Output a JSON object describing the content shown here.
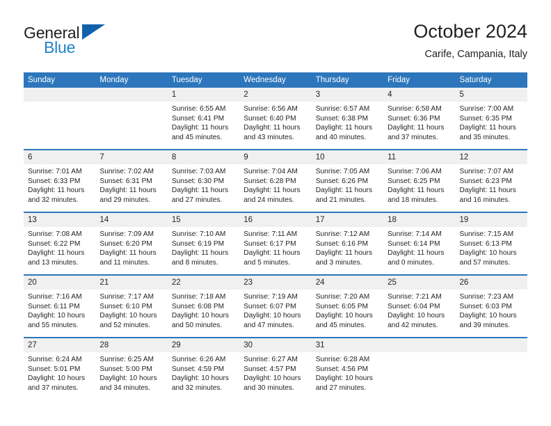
{
  "brand": {
    "name_part1": "General",
    "name_part2": "Blue",
    "triangle_color": "#1162ab",
    "blue_color": "#1d82c8"
  },
  "header": {
    "title": "October 2024",
    "location": "Carife, Campania, Italy"
  },
  "theme": {
    "header_row_bg": "#2d76bb",
    "daynum_bg": "#f0f0f0",
    "separator_color": "#2d76bb",
    "text_color": "#231f20"
  },
  "weekday_headers": [
    "Sunday",
    "Monday",
    "Tuesday",
    "Wednesday",
    "Thursday",
    "Friday",
    "Saturday"
  ],
  "weeks": [
    [
      {
        "day": "",
        "empty": true
      },
      {
        "day": "",
        "empty": true
      },
      {
        "day": "1",
        "sunrise": "Sunrise: 6:55 AM",
        "sunset": "Sunset: 6:41 PM",
        "daylight1": "Daylight: 11 hours",
        "daylight2": "and 45 minutes."
      },
      {
        "day": "2",
        "sunrise": "Sunrise: 6:56 AM",
        "sunset": "Sunset: 6:40 PM",
        "daylight1": "Daylight: 11 hours",
        "daylight2": "and 43 minutes."
      },
      {
        "day": "3",
        "sunrise": "Sunrise: 6:57 AM",
        "sunset": "Sunset: 6:38 PM",
        "daylight1": "Daylight: 11 hours",
        "daylight2": "and 40 minutes."
      },
      {
        "day": "4",
        "sunrise": "Sunrise: 6:58 AM",
        "sunset": "Sunset: 6:36 PM",
        "daylight1": "Daylight: 11 hours",
        "daylight2": "and 37 minutes."
      },
      {
        "day": "5",
        "sunrise": "Sunrise: 7:00 AM",
        "sunset": "Sunset: 6:35 PM",
        "daylight1": "Daylight: 11 hours",
        "daylight2": "and 35 minutes."
      }
    ],
    [
      {
        "day": "6",
        "sunrise": "Sunrise: 7:01 AM",
        "sunset": "Sunset: 6:33 PM",
        "daylight1": "Daylight: 11 hours",
        "daylight2": "and 32 minutes."
      },
      {
        "day": "7",
        "sunrise": "Sunrise: 7:02 AM",
        "sunset": "Sunset: 6:31 PM",
        "daylight1": "Daylight: 11 hours",
        "daylight2": "and 29 minutes."
      },
      {
        "day": "8",
        "sunrise": "Sunrise: 7:03 AM",
        "sunset": "Sunset: 6:30 PM",
        "daylight1": "Daylight: 11 hours",
        "daylight2": "and 27 minutes."
      },
      {
        "day": "9",
        "sunrise": "Sunrise: 7:04 AM",
        "sunset": "Sunset: 6:28 PM",
        "daylight1": "Daylight: 11 hours",
        "daylight2": "and 24 minutes."
      },
      {
        "day": "10",
        "sunrise": "Sunrise: 7:05 AM",
        "sunset": "Sunset: 6:26 PM",
        "daylight1": "Daylight: 11 hours",
        "daylight2": "and 21 minutes."
      },
      {
        "day": "11",
        "sunrise": "Sunrise: 7:06 AM",
        "sunset": "Sunset: 6:25 PM",
        "daylight1": "Daylight: 11 hours",
        "daylight2": "and 18 minutes."
      },
      {
        "day": "12",
        "sunrise": "Sunrise: 7:07 AM",
        "sunset": "Sunset: 6:23 PM",
        "daylight1": "Daylight: 11 hours",
        "daylight2": "and 16 minutes."
      }
    ],
    [
      {
        "day": "13",
        "sunrise": "Sunrise: 7:08 AM",
        "sunset": "Sunset: 6:22 PM",
        "daylight1": "Daylight: 11 hours",
        "daylight2": "and 13 minutes."
      },
      {
        "day": "14",
        "sunrise": "Sunrise: 7:09 AM",
        "sunset": "Sunset: 6:20 PM",
        "daylight1": "Daylight: 11 hours",
        "daylight2": "and 11 minutes."
      },
      {
        "day": "15",
        "sunrise": "Sunrise: 7:10 AM",
        "sunset": "Sunset: 6:19 PM",
        "daylight1": "Daylight: 11 hours",
        "daylight2": "and 8 minutes."
      },
      {
        "day": "16",
        "sunrise": "Sunrise: 7:11 AM",
        "sunset": "Sunset: 6:17 PM",
        "daylight1": "Daylight: 11 hours",
        "daylight2": "and 5 minutes."
      },
      {
        "day": "17",
        "sunrise": "Sunrise: 7:12 AM",
        "sunset": "Sunset: 6:16 PM",
        "daylight1": "Daylight: 11 hours",
        "daylight2": "and 3 minutes."
      },
      {
        "day": "18",
        "sunrise": "Sunrise: 7:14 AM",
        "sunset": "Sunset: 6:14 PM",
        "daylight1": "Daylight: 11 hours",
        "daylight2": "and 0 minutes."
      },
      {
        "day": "19",
        "sunrise": "Sunrise: 7:15 AM",
        "sunset": "Sunset: 6:13 PM",
        "daylight1": "Daylight: 10 hours",
        "daylight2": "and 57 minutes."
      }
    ],
    [
      {
        "day": "20",
        "sunrise": "Sunrise: 7:16 AM",
        "sunset": "Sunset: 6:11 PM",
        "daylight1": "Daylight: 10 hours",
        "daylight2": "and 55 minutes."
      },
      {
        "day": "21",
        "sunrise": "Sunrise: 7:17 AM",
        "sunset": "Sunset: 6:10 PM",
        "daylight1": "Daylight: 10 hours",
        "daylight2": "and 52 minutes."
      },
      {
        "day": "22",
        "sunrise": "Sunrise: 7:18 AM",
        "sunset": "Sunset: 6:08 PM",
        "daylight1": "Daylight: 10 hours",
        "daylight2": "and 50 minutes."
      },
      {
        "day": "23",
        "sunrise": "Sunrise: 7:19 AM",
        "sunset": "Sunset: 6:07 PM",
        "daylight1": "Daylight: 10 hours",
        "daylight2": "and 47 minutes."
      },
      {
        "day": "24",
        "sunrise": "Sunrise: 7:20 AM",
        "sunset": "Sunset: 6:05 PM",
        "daylight1": "Daylight: 10 hours",
        "daylight2": "and 45 minutes."
      },
      {
        "day": "25",
        "sunrise": "Sunrise: 7:21 AM",
        "sunset": "Sunset: 6:04 PM",
        "daylight1": "Daylight: 10 hours",
        "daylight2": "and 42 minutes."
      },
      {
        "day": "26",
        "sunrise": "Sunrise: 7:23 AM",
        "sunset": "Sunset: 6:03 PM",
        "daylight1": "Daylight: 10 hours",
        "daylight2": "and 39 minutes."
      }
    ],
    [
      {
        "day": "27",
        "sunrise": "Sunrise: 6:24 AM",
        "sunset": "Sunset: 5:01 PM",
        "daylight1": "Daylight: 10 hours",
        "daylight2": "and 37 minutes."
      },
      {
        "day": "28",
        "sunrise": "Sunrise: 6:25 AM",
        "sunset": "Sunset: 5:00 PM",
        "daylight1": "Daylight: 10 hours",
        "daylight2": "and 34 minutes."
      },
      {
        "day": "29",
        "sunrise": "Sunrise: 6:26 AM",
        "sunset": "Sunset: 4:59 PM",
        "daylight1": "Daylight: 10 hours",
        "daylight2": "and 32 minutes."
      },
      {
        "day": "30",
        "sunrise": "Sunrise: 6:27 AM",
        "sunset": "Sunset: 4:57 PM",
        "daylight1": "Daylight: 10 hours",
        "daylight2": "and 30 minutes."
      },
      {
        "day": "31",
        "sunrise": "Sunrise: 6:28 AM",
        "sunset": "Sunset: 4:56 PM",
        "daylight1": "Daylight: 10 hours",
        "daylight2": "and 27 minutes."
      },
      {
        "day": "",
        "empty": true
      },
      {
        "day": "",
        "empty": true
      }
    ]
  ]
}
